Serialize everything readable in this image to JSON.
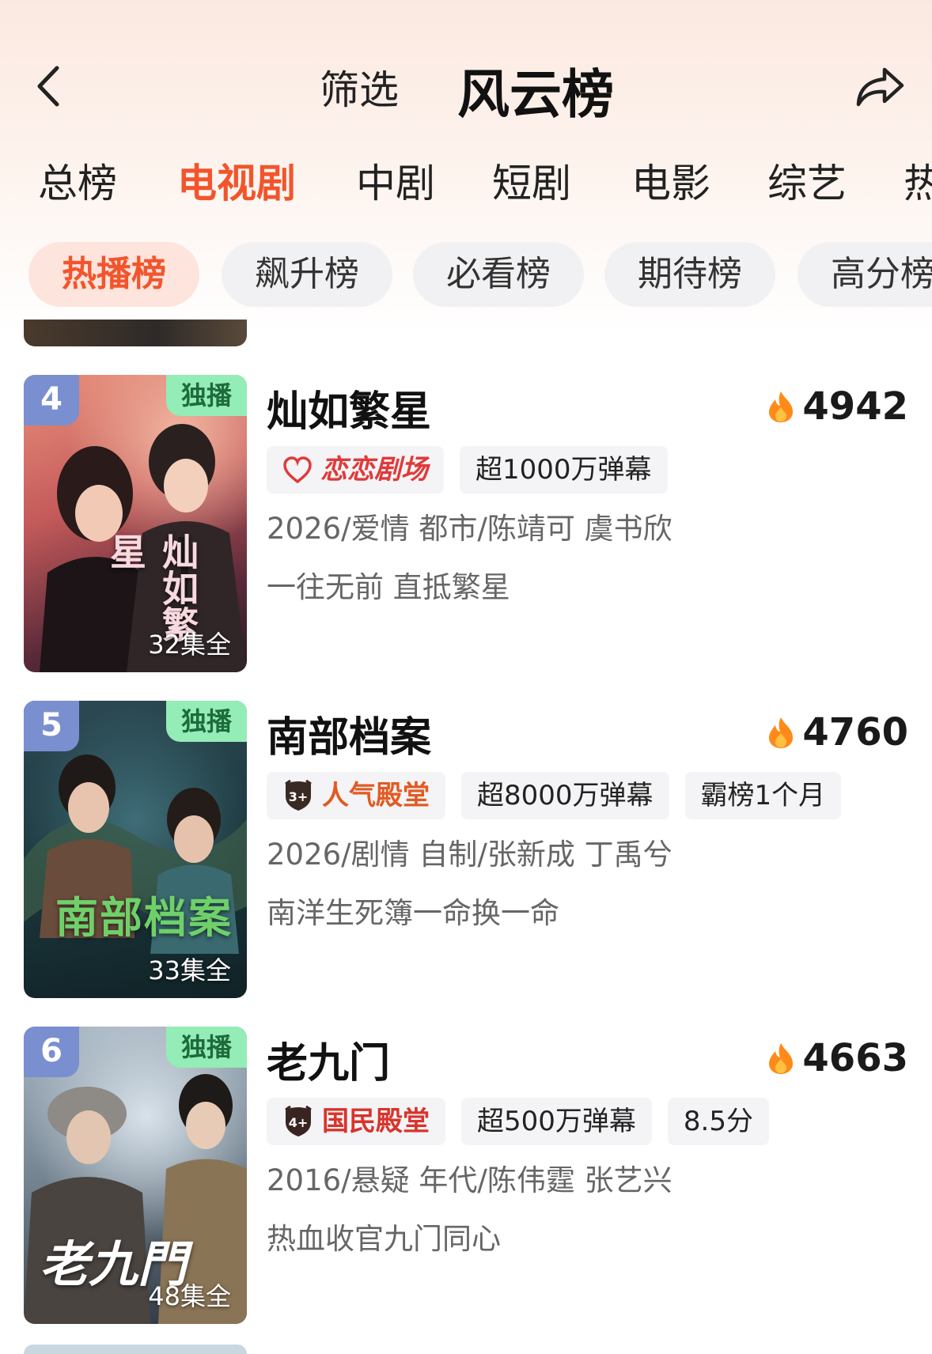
{
  "header": {
    "filter_label": "筛选",
    "title": "风云榜"
  },
  "category_tabs": [
    "总榜",
    "电视剧",
    "中剧",
    "短剧",
    "电影",
    "综艺",
    "热"
  ],
  "category_active": "电视剧",
  "rank_tabs": [
    "热播榜",
    "飙升榜",
    "必看榜",
    "期待榜",
    "高分榜"
  ],
  "rank_active": "热播榜",
  "items": [
    {
      "rank": "4",
      "badge": "独播",
      "episodes": "32集全",
      "poster_title": "灿如繁星",
      "title": "灿如繁星",
      "heat": "4942",
      "tags": [
        "恋恋剧场",
        "超1000万弹幕"
      ],
      "meta": "2026/爱情 都市/陈靖可 虞书欣",
      "slogan": "一往无前 直抵繁星"
    },
    {
      "rank": "5",
      "badge": "独播",
      "episodes": "33集全",
      "poster_title": "南部档案",
      "title": "南部档案",
      "heat": "4760",
      "hall_badge": "3+",
      "tags": [
        "人气殿堂",
        "超8000万弹幕",
        "霸榜1个月"
      ],
      "meta": "2026/剧情 自制/张新成 丁禹兮",
      "slogan": "南洋生死簿一命换一命"
    },
    {
      "rank": "6",
      "badge": "独播",
      "episodes": "48集全",
      "poster_title": "老九門",
      "title": "老九门",
      "heat": "4663",
      "hall_badge": "4+",
      "tags": [
        "国民殿堂",
        "超500万弹幕",
        "8.5分"
      ],
      "meta": "2016/悬疑 年代/陈伟霆 张艺兴",
      "slogan": "热血收官九门同心"
    }
  ],
  "colors": {
    "accent": "#f2552c",
    "rank_badge": "#7a8fd0",
    "exclusive_badge": "#94ecb6"
  }
}
